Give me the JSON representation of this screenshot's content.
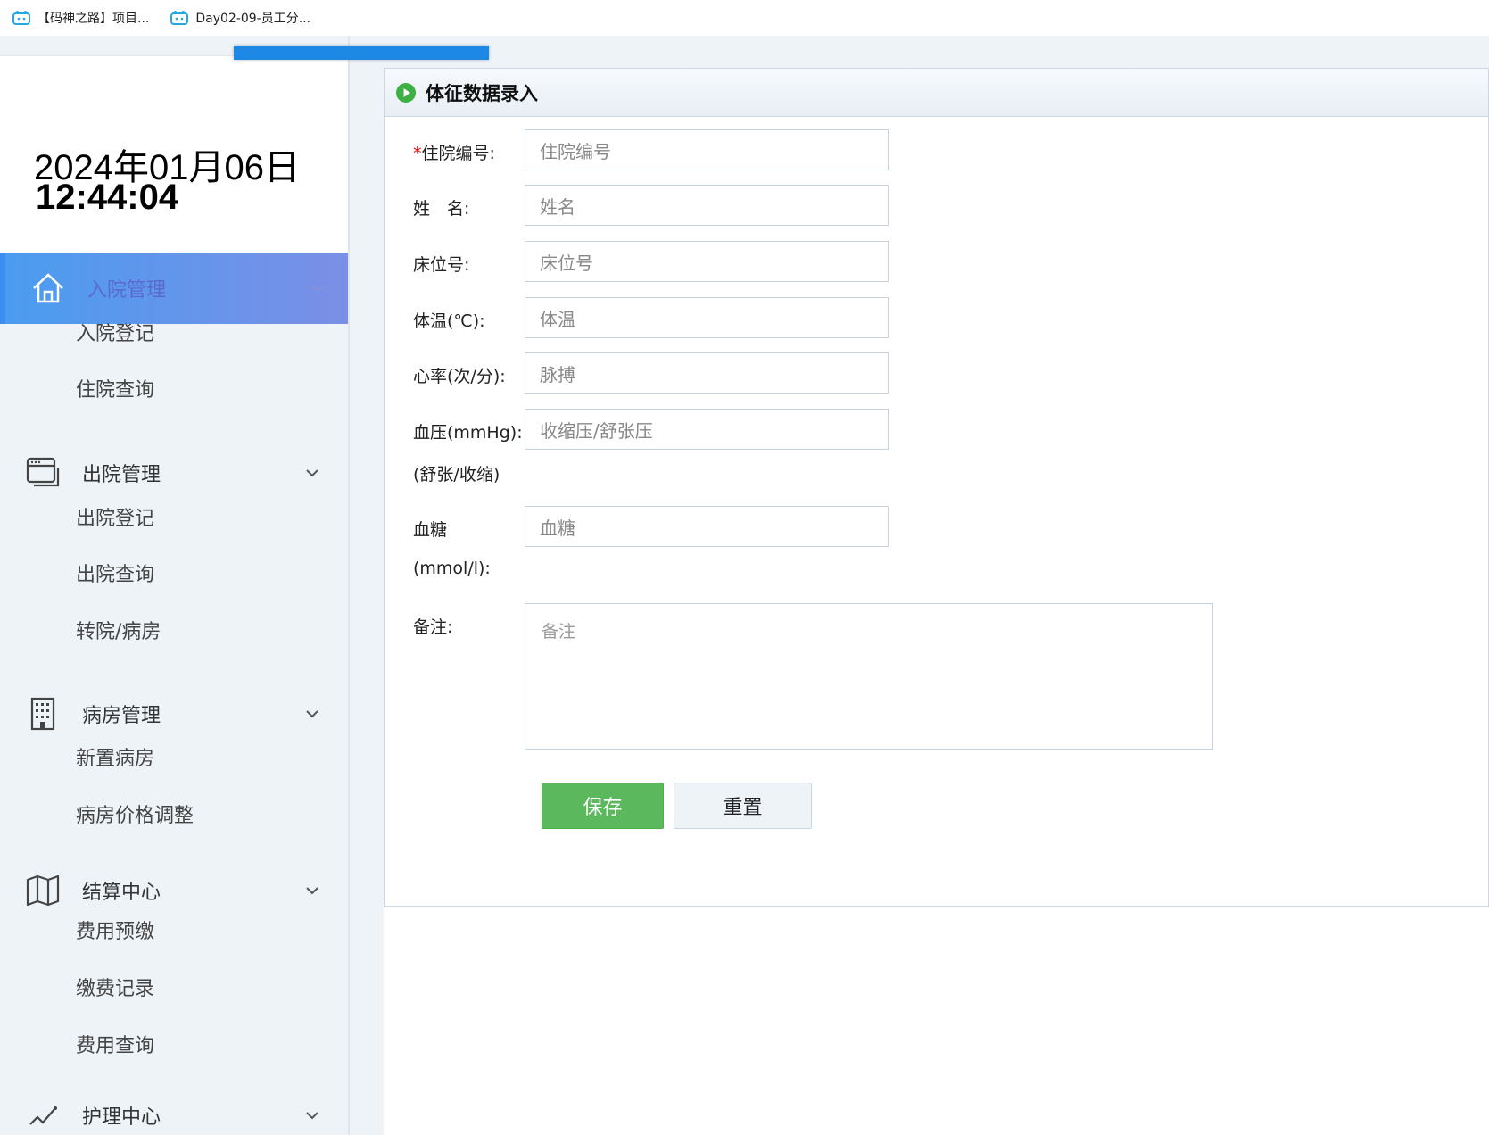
{
  "bookmarks": [
    {
      "label": "【码神之路】项目..."
    },
    {
      "label": "Day02-09-员工分..."
    }
  ],
  "clock": {
    "date": "2024年01月06日",
    "time": "12:44:04"
  },
  "sidebar": {
    "groups": [
      {
        "label": "入院管理",
        "icon": "home-icon",
        "active": true,
        "items": [
          "入院登记",
          "住院查询"
        ]
      },
      {
        "label": "出院管理",
        "icon": "window-stack-icon",
        "active": false,
        "items": [
          "出院登记",
          "出院查询",
          "转院/病房"
        ]
      },
      {
        "label": "病房管理",
        "icon": "building-icon",
        "active": false,
        "items": [
          "新置病房",
          "病房价格调整"
        ]
      },
      {
        "label": "结算中心",
        "icon": "map-icon",
        "active": false,
        "items": [
          "费用预缴",
          "缴费记录",
          "费用查询"
        ]
      },
      {
        "label": "护理中心",
        "icon": "nursing-icon",
        "active": false,
        "items": []
      }
    ]
  },
  "panel": {
    "title": "体征数据录入"
  },
  "form": {
    "hospital_no": {
      "required_mark": "*",
      "label": "住院编号:",
      "placeholder": "住院编号"
    },
    "name": {
      "label": "姓　名:",
      "placeholder": "姓名"
    },
    "bed_no": {
      "label": "床位号:",
      "placeholder": "床位号"
    },
    "temperature": {
      "label": "体温(℃):",
      "placeholder": "体温"
    },
    "heart_rate": {
      "label": "心率(次/分):",
      "placeholder": "脉搏"
    },
    "blood_pressure": {
      "label_line1": "血压(mmHg):",
      "label_line2": "(舒张/收缩)",
      "placeholder": "收缩压/舒张压"
    },
    "blood_sugar": {
      "label_line1": "血糖",
      "label_line2": "(mmol/l):",
      "placeholder": "血糖"
    },
    "remarks": {
      "label": "备注:",
      "placeholder": "备注"
    },
    "save_label": "保存",
    "reset_label": "重置"
  },
  "colors": {
    "active_gradient_start": "#4a9cf0",
    "active_gradient_end": "#7b8fe6",
    "save_button": "#5cb85c",
    "progress_bar": "#1e88e5",
    "sidebar_bg": "#eef3f8"
  }
}
